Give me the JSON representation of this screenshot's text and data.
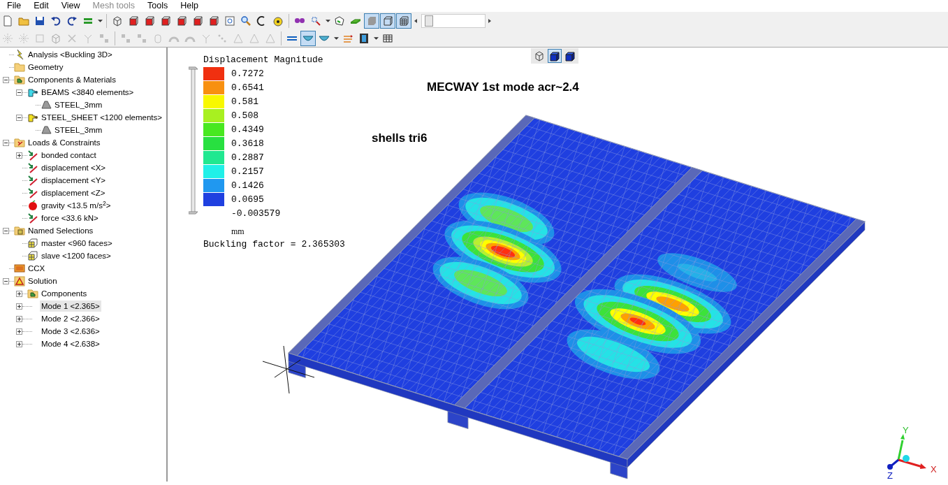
{
  "menu": [
    {
      "label": "File",
      "disabled": false
    },
    {
      "label": "Edit",
      "disabled": false
    },
    {
      "label": "View",
      "disabled": false
    },
    {
      "label": "Mesh tools",
      "disabled": true
    },
    {
      "label": "Tools",
      "disabled": false
    },
    {
      "label": "Help",
      "disabled": false
    }
  ],
  "toolbar_1": [
    {
      "kind": "new",
      "selected": false,
      "disabled": false
    },
    {
      "kind": "open",
      "selected": false,
      "disabled": false
    },
    {
      "kind": "save",
      "selected": false,
      "disabled": false
    },
    {
      "kind": "undo",
      "selected": false,
      "disabled": false
    },
    {
      "kind": "redo",
      "selected": false,
      "disabled": false
    },
    {
      "kind": "layers",
      "selected": false,
      "disabled": false
    },
    {
      "kind": "caret",
      "selected": false,
      "disabled": false
    },
    {
      "kind": "sep"
    },
    {
      "kind": "cube-wire",
      "selected": false,
      "disabled": false
    },
    {
      "kind": "cube-face",
      "selected": false,
      "disabled": false
    },
    {
      "kind": "cube-face",
      "selected": false,
      "disabled": false
    },
    {
      "kind": "cube-face",
      "selected": false,
      "disabled": false
    },
    {
      "kind": "cube-face",
      "selected": false,
      "disabled": false
    },
    {
      "kind": "cube-face",
      "selected": false,
      "disabled": false
    },
    {
      "kind": "cube-face",
      "selected": false,
      "disabled": false
    },
    {
      "kind": "zoom-box",
      "selected": false,
      "disabled": false
    },
    {
      "kind": "magnifier",
      "selected": false,
      "disabled": false
    },
    {
      "kind": "rotate",
      "selected": false,
      "disabled": false
    },
    {
      "kind": "tape",
      "selected": false,
      "disabled": false
    },
    {
      "kind": "sep"
    },
    {
      "kind": "glasses",
      "selected": false,
      "disabled": false
    },
    {
      "kind": "probe",
      "selected": false,
      "disabled": false
    },
    {
      "kind": "caret",
      "selected": false,
      "disabled": false
    },
    {
      "kind": "node",
      "selected": false,
      "disabled": false
    },
    {
      "kind": "plate",
      "selected": false,
      "disabled": false
    },
    {
      "kind": "view-shaded",
      "selected": true,
      "disabled": false
    },
    {
      "kind": "view-wire",
      "selected": true,
      "disabled": false
    },
    {
      "kind": "view-mesh",
      "selected": true,
      "disabled": false
    }
  ],
  "zoom_slider": {
    "level": 0.05
  },
  "toolbar_2": [
    {
      "kind": "burst",
      "selected": false,
      "disabled": true
    },
    {
      "kind": "burst",
      "selected": false,
      "disabled": true
    },
    {
      "kind": "square",
      "selected": false,
      "disabled": true
    },
    {
      "kind": "cube-wire",
      "selected": false,
      "disabled": true
    },
    {
      "kind": "cross",
      "selected": false,
      "disabled": true
    },
    {
      "kind": "branch",
      "selected": false,
      "disabled": true
    },
    {
      "kind": "nodes",
      "selected": false,
      "disabled": true
    },
    {
      "kind": "sep"
    },
    {
      "kind": "nodes",
      "selected": false,
      "disabled": true
    },
    {
      "kind": "nodes",
      "selected": false,
      "disabled": true
    },
    {
      "kind": "cylinder",
      "selected": false,
      "disabled": true
    },
    {
      "kind": "arc",
      "selected": false,
      "disabled": true
    },
    {
      "kind": "arc",
      "selected": false,
      "disabled": true
    },
    {
      "kind": "branch",
      "selected": false,
      "disabled": true
    },
    {
      "kind": "dots",
      "selected": false,
      "disabled": true
    },
    {
      "kind": "triangle",
      "selected": false,
      "disabled": true
    },
    {
      "kind": "triangle",
      "selected": false,
      "disabled": true
    },
    {
      "kind": "triangle",
      "selected": false,
      "disabled": true
    },
    {
      "kind": "sep"
    },
    {
      "kind": "line",
      "selected": false,
      "disabled": false
    },
    {
      "kind": "bowl",
      "selected": true,
      "disabled": false
    },
    {
      "kind": "bowl",
      "selected": false,
      "disabled": false
    },
    {
      "kind": "caret",
      "selected": false,
      "disabled": false
    },
    {
      "kind": "arrows",
      "selected": false,
      "disabled": false
    },
    {
      "kind": "film",
      "selected": false,
      "disabled": false
    },
    {
      "kind": "caret",
      "selected": false,
      "disabled": false
    },
    {
      "kind": "table",
      "selected": false,
      "disabled": false
    }
  ],
  "tree": [
    {
      "label": "Analysis <Buckling 3D>",
      "kind": "analysis",
      "selected": false
    },
    {
      "label": "Geometry",
      "kind": "folder",
      "selected": false
    },
    {
      "label": "Components & Materials",
      "kind": "component-folder",
      "selected": false,
      "expanded": true,
      "children": [
        {
          "label": "BEAMS <3840 elements>",
          "kind": "component-cyan",
          "selected": false,
          "expanded": true,
          "children": [
            {
              "label": "STEEL_3mm",
              "kind": "material",
              "selected": false
            }
          ]
        },
        {
          "label": "STEEL_SHEET <1200 elements>",
          "kind": "component-yellow",
          "selected": false,
          "expanded": true,
          "children": [
            {
              "label": "STEEL_3mm",
              "kind": "material",
              "selected": false
            }
          ]
        }
      ]
    },
    {
      "label": "Loads & Constraints",
      "kind": "load-folder",
      "selected": false,
      "expanded": true,
      "children": [
        {
          "label": "bonded contact",
          "kind": "constraint",
          "selected": false,
          "expanded": false
        },
        {
          "label": "displacement <X>",
          "kind": "constraint",
          "selected": false
        },
        {
          "label": "displacement <Y>",
          "kind": "constraint",
          "selected": false
        },
        {
          "label": "displacement <Z>",
          "kind": "constraint",
          "selected": false
        },
        {
          "label": "gravity <13.5 m/s$^{2}$>",
          "kind": "gravity",
          "selected": false
        },
        {
          "label": "force <33.6 kN>",
          "kind": "constraint",
          "selected": false
        }
      ]
    },
    {
      "label": "Named Selections",
      "kind": "selection-folder",
      "selected": false,
      "expanded": true,
      "children": [
        {
          "label": "master <960 faces>",
          "kind": "selection",
          "selected": false
        },
        {
          "label": "slave <1200 faces>",
          "kind": "selection",
          "selected": false
        }
      ]
    },
    {
      "label": "CCX",
      "kind": "solver",
      "selected": false
    },
    {
      "label": "Solution",
      "kind": "solution",
      "selected": false,
      "expanded": true,
      "children": [
        {
          "label": "Components",
          "kind": "component-folder",
          "selected": false,
          "expanded": false
        },
        {
          "label": "Mode 1 <2.365>",
          "kind": "mode",
          "selected": true,
          "expanded": false
        },
        {
          "label": "Mode 2 <2.366>",
          "kind": "mode",
          "selected": false,
          "expanded": false
        },
        {
          "label": "Mode 3 <2.636>",
          "kind": "mode",
          "selected": false,
          "expanded": false
        },
        {
          "label": "Mode 4 <2.638>",
          "kind": "mode",
          "selected": false,
          "expanded": false
        }
      ]
    }
  ],
  "view_buttons": [
    {
      "kind": "cube-wire",
      "selected": false
    },
    {
      "kind": "cube-solid",
      "selected": true
    },
    {
      "kind": "cube-solid",
      "selected": false
    }
  ],
  "legend": {
    "title": "Displacement Magnitude",
    "range_slider": {
      "level": 1
    },
    "entries": [
      {
        "value": "0.7272",
        "color": "#f03010"
      },
      {
        "value": "0.6541",
        "color": "#f89010"
      },
      {
        "value": "0.581",
        "color": "#f8f800"
      },
      {
        "value": "0.508",
        "color": "#a8f020"
      },
      {
        "value": "0.4349",
        "color": "#48e820"
      },
      {
        "value": "0.3618",
        "color": "#28e040"
      },
      {
        "value": "0.2887",
        "color": "#20e890"
      },
      {
        "value": "0.2157",
        "color": "#20f0e8"
      },
      {
        "value": "0.1426",
        "color": "#2098f0"
      },
      {
        "value": "0.0695",
        "color": "#1f40e0"
      }
    ],
    "last_value": "-0.003579",
    "unit": "mm",
    "footer": "Buckling factor = 2.365303"
  },
  "titles": [
    "MECWAY 1st mode acr~2.4",
    "shells tri6"
  ],
  "axes": [
    "Y",
    "X",
    "Z"
  ]
}
